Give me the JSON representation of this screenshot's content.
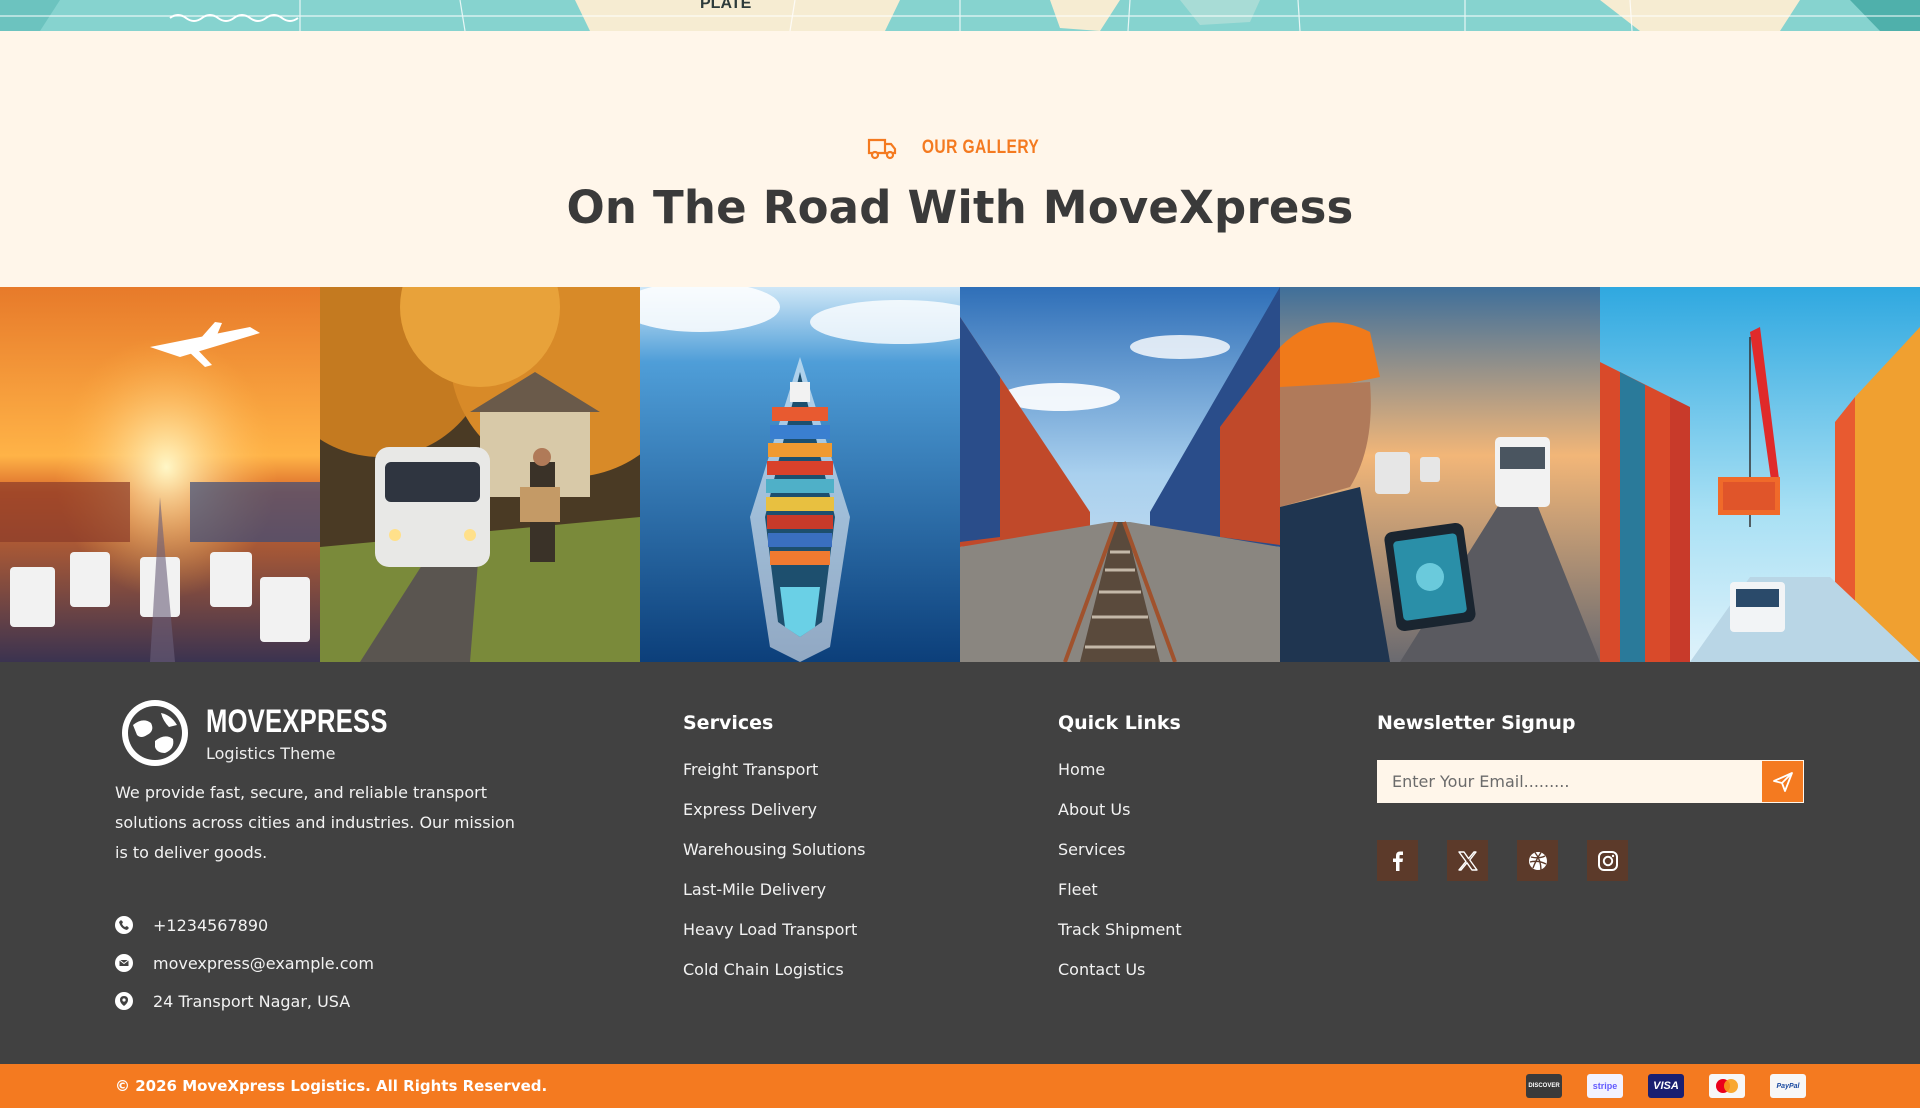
{
  "map": {
    "label": "PLATE"
  },
  "gallery": {
    "eyebrow": "OUR GALLERY",
    "eyebrow_icon": "truck-icon",
    "title": "On The Road With MoveXpress",
    "images": [
      {
        "name": "air-and-road-freight-image"
      },
      {
        "name": "van-delivery-image"
      },
      {
        "name": "container-ship-image"
      },
      {
        "name": "rail-freight-image"
      },
      {
        "name": "worker-tablet-trucks-image"
      },
      {
        "name": "container-yard-crane-image"
      }
    ]
  },
  "footer": {
    "brand": {
      "name": "MOVEXPRESS",
      "tagline": "Logistics Theme",
      "logo_icon": "globe-icon"
    },
    "about": "We provide fast, secure, and reliable transport solutions across cities and industries. Our mission is to deliver goods.",
    "contacts": [
      {
        "icon": "phone-icon",
        "text": "+1234567890"
      },
      {
        "icon": "mail-icon",
        "text": "movexpress@example.com"
      },
      {
        "icon": "location-pin-icon",
        "text": "24 Transport Nagar, USA"
      }
    ],
    "services": {
      "heading": "Services",
      "items": [
        "Freight Transport",
        "Express Delivery",
        "Warehousing Solutions",
        "Last-Mile Delivery",
        "Heavy Load Transport",
        "Cold Chain Logistics"
      ]
    },
    "quick_links": {
      "heading": "Quick Links",
      "items": [
        "Home",
        "About Us",
        "Services",
        "Fleet",
        "Track Shipment",
        "Contact Us"
      ]
    },
    "newsletter": {
      "heading": "Newsletter Signup",
      "placeholder": "Enter Your Email.........",
      "submit_icon": "send-icon"
    },
    "socials": [
      "facebook-icon",
      "x-twitter-icon",
      "dribbble-icon",
      "instagram-icon"
    ]
  },
  "bottom_bar": {
    "copyright": "© 2026 MoveXpress Logistics. All Rights Reserved.",
    "payments": [
      "DISCOVER",
      "stripe",
      "VISA",
      "mastercard",
      "PayPal"
    ]
  },
  "colors": {
    "accent": "#f47a20",
    "footer_bg": "#414141",
    "cream": "#fff6ea",
    "social_bg": "#5c3a2a"
  }
}
